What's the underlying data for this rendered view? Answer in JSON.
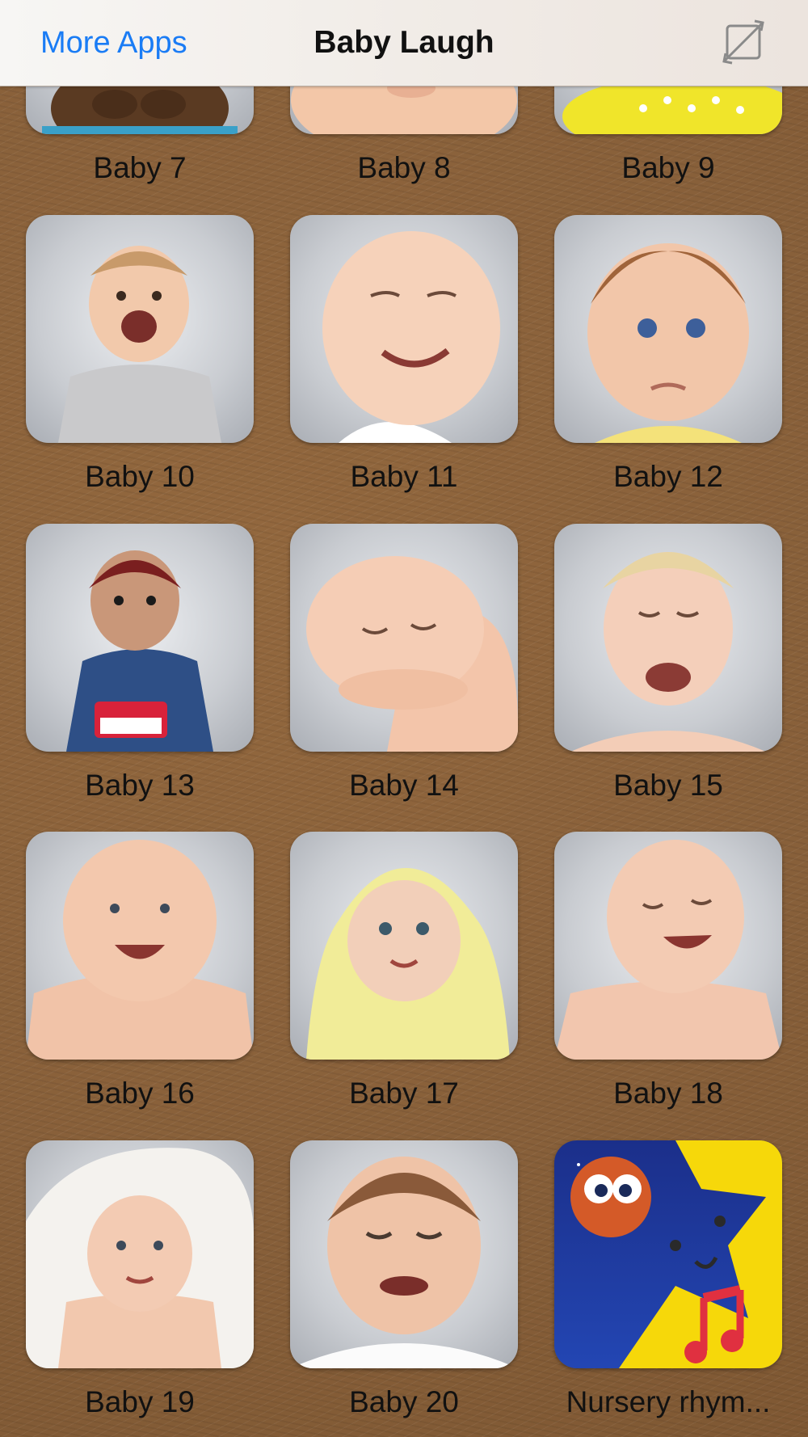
{
  "navbar": {
    "left_button": "More Apps",
    "title": "Baby Laugh",
    "right_icon": "rotate-lock-icon"
  },
  "grid": {
    "items": [
      {
        "label": "Baby 7"
      },
      {
        "label": "Baby 8"
      },
      {
        "label": "Baby 9"
      },
      {
        "label": "Baby 10"
      },
      {
        "label": "Baby 11"
      },
      {
        "label": "Baby 12"
      },
      {
        "label": "Baby 13"
      },
      {
        "label": "Baby 14"
      },
      {
        "label": "Baby 15"
      },
      {
        "label": "Baby 16"
      },
      {
        "label": "Baby 17"
      },
      {
        "label": "Baby 18"
      },
      {
        "label": "Baby 19"
      },
      {
        "label": "Baby 20"
      },
      {
        "label": "Nursery rhym..."
      }
    ]
  },
  "colors": {
    "accent": "#1a7cf5",
    "background": "#8c6239",
    "tile_bg": "#c9ccd1"
  }
}
